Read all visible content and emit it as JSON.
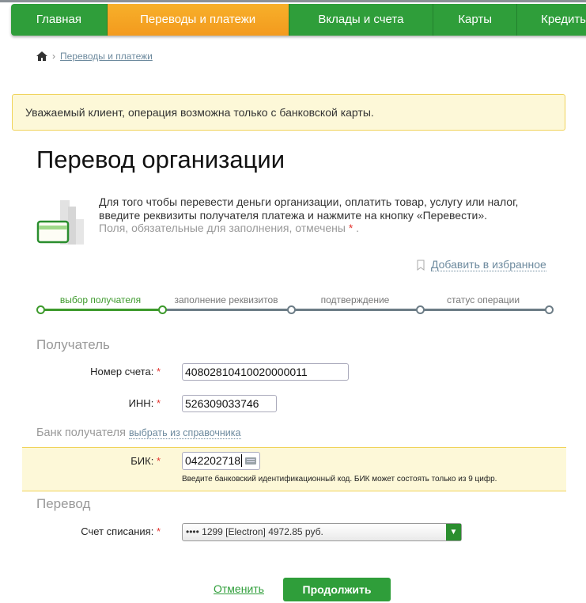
{
  "nav": {
    "tabs": [
      "Главная",
      "Переводы и платежи",
      "Вклады и счета",
      "Карты",
      "Кредиты"
    ]
  },
  "breadcrumb": {
    "link": "Переводы и платежи"
  },
  "alert": "Уважаемый клиент, операция возможна только с банковской карты.",
  "title": "Перевод организации",
  "info": {
    "line1": "Для того чтобы перевести деньги организации, оплатить товар, услугу или налог,",
    "line2": "введите реквизиты получателя платежа и нажмите на кнопку «Перевести».",
    "line3": "Поля, обязательные для заполнения, отмечены",
    "star": "*",
    "dot": "."
  },
  "favorites": "Добавить в избранное",
  "steps": [
    "выбор получателя",
    "заполнение реквизитов",
    "подтверждение",
    "статус операции"
  ],
  "recipient": {
    "heading": "Получатель",
    "account_label": "Номер счета:",
    "account_value": "40802810410020000011",
    "inn_label": "ИНН:",
    "inn_value": "526309033746"
  },
  "bank": {
    "heading": "Банк получателя",
    "choose_link": "выбрать из справочника",
    "bik_label": "БИК:",
    "bik_value": "042202718",
    "bik_hint": "Введите банковский идентификационный код. БИК может состоять только из 9 цифр."
  },
  "transfer": {
    "heading": "Перевод",
    "debit_label": "Счет списания:",
    "debit_value": "•••• 1299 [Electron] 4972.85 руб."
  },
  "actions": {
    "cancel": "Отменить",
    "continue": "Продолжить"
  },
  "colors": {
    "green": "#2f9e3a",
    "orange": "#f39a1e",
    "alert_bg": "#fdf8d8"
  }
}
